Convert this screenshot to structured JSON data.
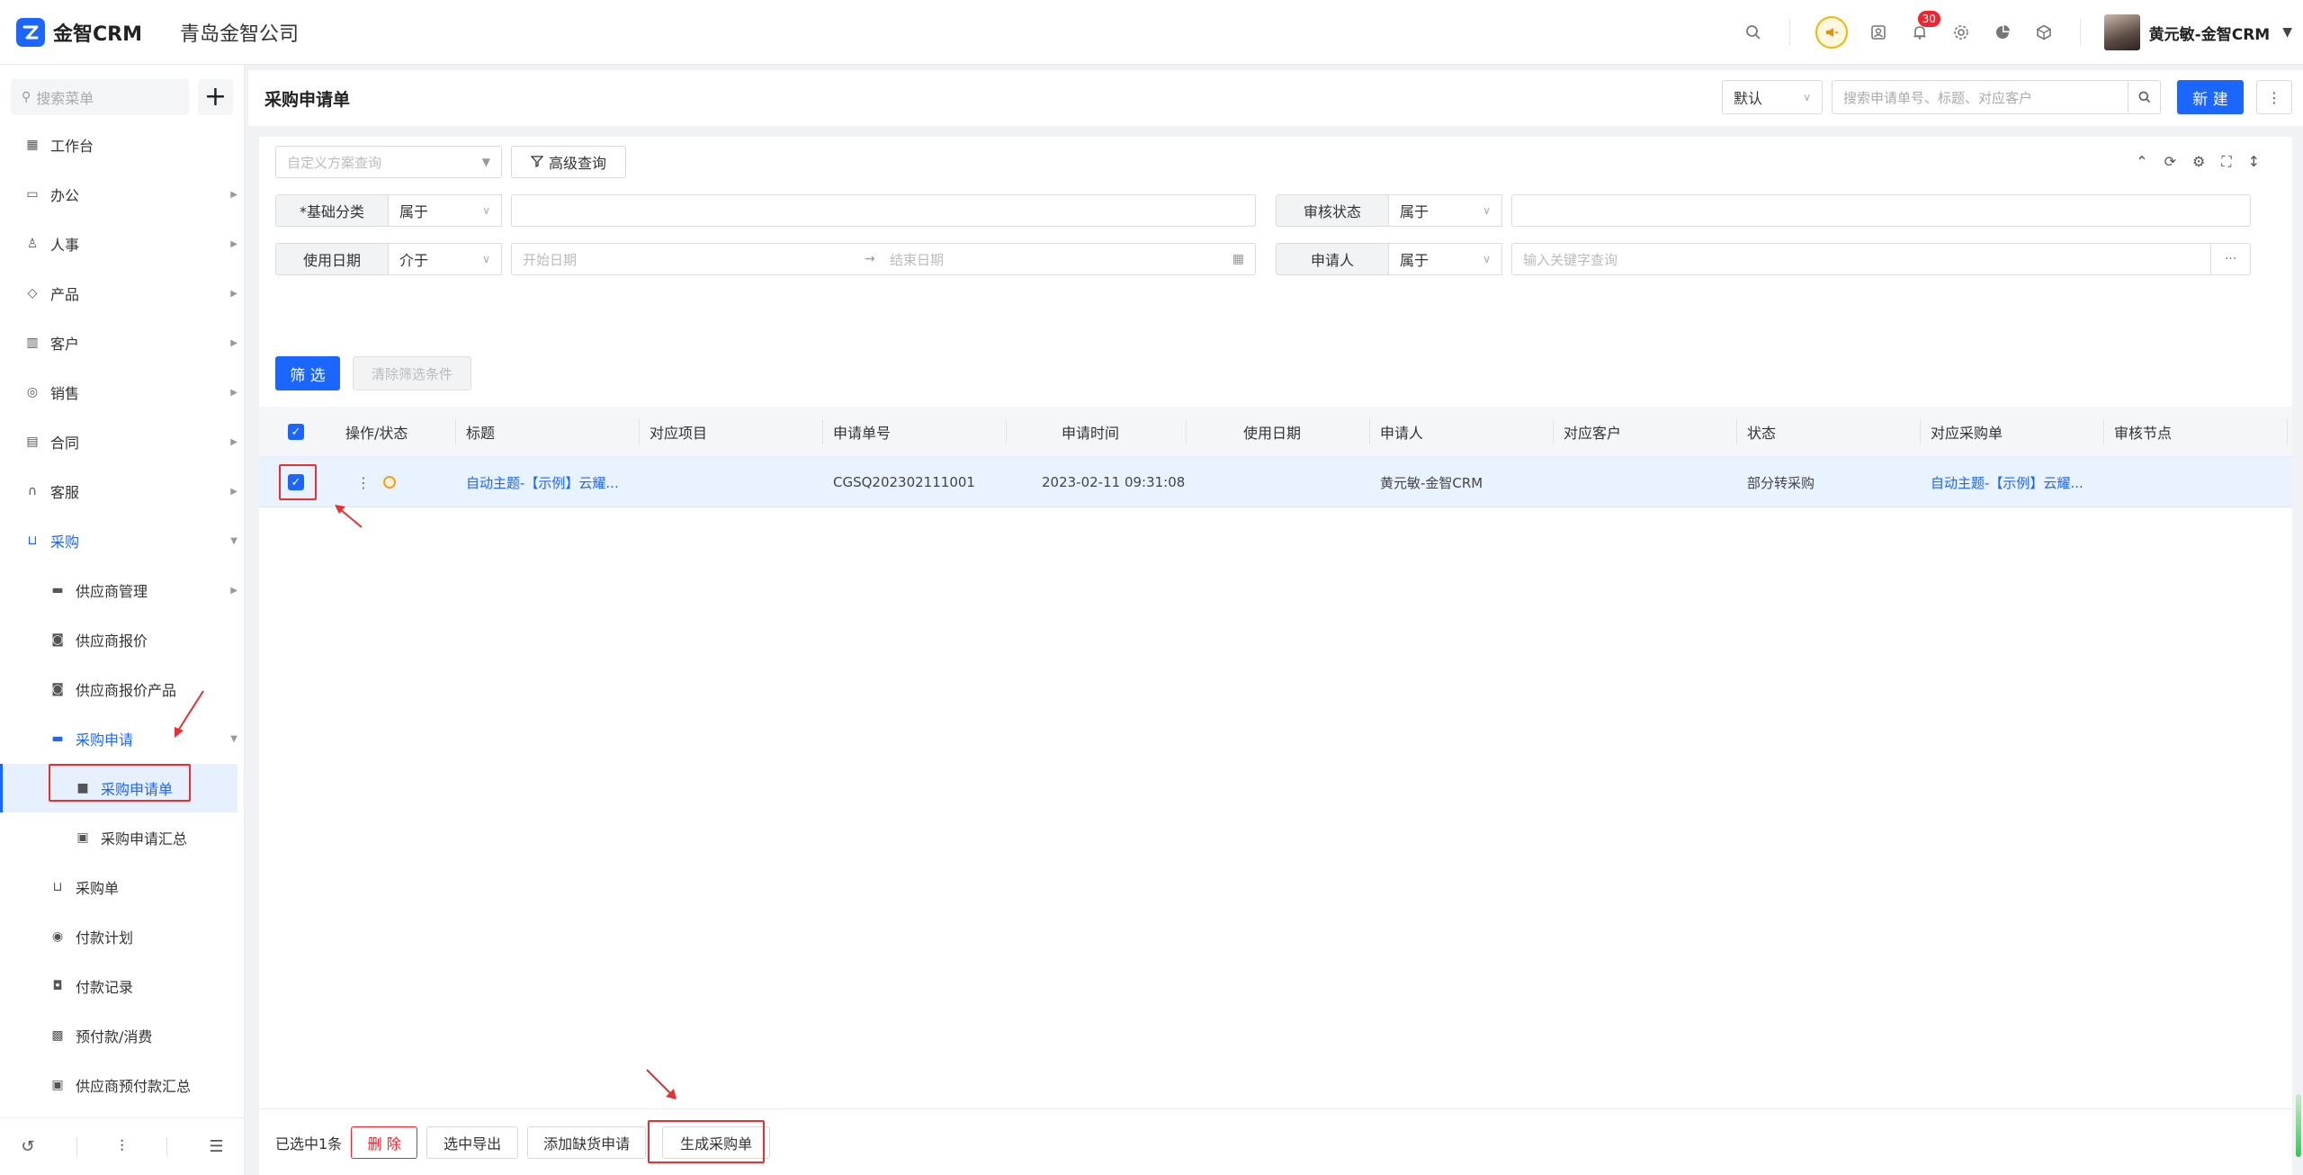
{
  "app": {
    "logo_text": "金智CRM",
    "company": "青岛金智公司"
  },
  "topbar": {
    "notification_count": "30",
    "user_name": "黄元敏-金智CRM"
  },
  "sidebar": {
    "search_placeholder": "搜索菜单",
    "add_label": "+",
    "items": [
      {
        "label": "工作台"
      },
      {
        "label": "办公"
      },
      {
        "label": "人事"
      },
      {
        "label": "产品"
      },
      {
        "label": "客户"
      },
      {
        "label": "销售"
      },
      {
        "label": "合同"
      },
      {
        "label": "客服"
      },
      {
        "label": "采购"
      },
      {
        "label": "供应商管理"
      },
      {
        "label": "供应商报价"
      },
      {
        "label": "供应商报价产品"
      },
      {
        "label": "采购申请"
      },
      {
        "label": "采购申请单"
      },
      {
        "label": "采购申请汇总"
      },
      {
        "label": "采购单"
      },
      {
        "label": "付款计划"
      },
      {
        "label": "付款记录"
      },
      {
        "label": "预付款/消费"
      },
      {
        "label": "供应商预付款汇总"
      }
    ]
  },
  "header": {
    "title": "采购申请单",
    "view_select": "默认",
    "search_placeholder": "搜索申请单号、标题、对应客户",
    "new_label": "新 建"
  },
  "filters": {
    "scheme_placeholder": "自定义方案查询",
    "advanced_label": "高级查询",
    "row1": {
      "left_label": "*基础分类",
      "left_op": "属于",
      "right_label": "审核状态",
      "right_op": "属于"
    },
    "row2": {
      "left_label": "使用日期",
      "left_op": "介于",
      "start_placeholder": "开始日期",
      "end_placeholder": "结束日期",
      "right_label": "申请人",
      "right_op": "属于",
      "keyword_placeholder": "输入关键字查询"
    },
    "filter_button": "筛 选",
    "clear_button": "清除筛选条件"
  },
  "table": {
    "columns": [
      "操作/状态",
      "标题",
      "对应项目",
      "申请单号",
      "申请时间",
      "使用日期",
      "申请人",
      "对应客户",
      "状态",
      "对应采购单",
      "审核节点"
    ],
    "rows": [
      {
        "title": "自动主题-【示例】云耀...",
        "project": "",
        "number": "CGSQ202302111001",
        "time": "2023-02-11 09:31:08",
        "use_date": "",
        "applicant": "黄元敏-金智CRM",
        "customer": "",
        "status": "部分转采购",
        "purchase_order": "自动主题-【示例】云耀...",
        "audit_node": ""
      }
    ]
  },
  "bottom": {
    "selected_text": "已选中1条",
    "delete_label": "删 除",
    "export_label": "选中导出",
    "add_shortage_label": "添加缺货申请",
    "generate_label": "生成采购单"
  },
  "colors": {
    "primary": "#1a66ff",
    "danger": "#f5222d",
    "annotation": "#e83030"
  }
}
